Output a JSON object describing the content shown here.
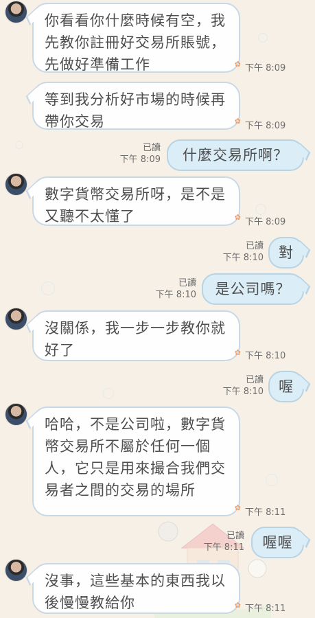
{
  "messages": [
    {
      "text": "你看看你什麼時候有空，我先教你註冊好交易所賬號，先做好準備工作",
      "time": "下午 8:09"
    },
    {
      "text": "等到我分析好市場的時候再帶你交易",
      "time": "下午 8:09"
    },
    {
      "read": "已讀",
      "time": "下午 8:09",
      "text": "什麼交易所啊？"
    },
    {
      "text": "數字貨幣交易所呀，是不是又聽不太懂了",
      "time": "下午 8:09"
    },
    {
      "read": "已讀",
      "time": "下午 8:10",
      "text": "對"
    },
    {
      "read": "已讀",
      "time": "下午 8:10",
      "text": "是公司嗎？"
    },
    {
      "text": "沒關係，我一步一步教你就好了",
      "time": "下午 8:10"
    },
    {
      "read": "已讀",
      "time": "下午 8:10",
      "text": "喔"
    },
    {
      "text": "哈哈，不是公司啦，數字貨幣交易所不屬於任何一個人，它只是用來撮合我們交易者之間的交易的場所",
      "time": "下午 8:11"
    },
    {
      "read": "已讀",
      "time": "下午 8:11",
      "text": "喔喔"
    },
    {
      "text": "沒事，這些基本的東西我以後慢慢教給你",
      "time": "下午 8:11"
    }
  ]
}
